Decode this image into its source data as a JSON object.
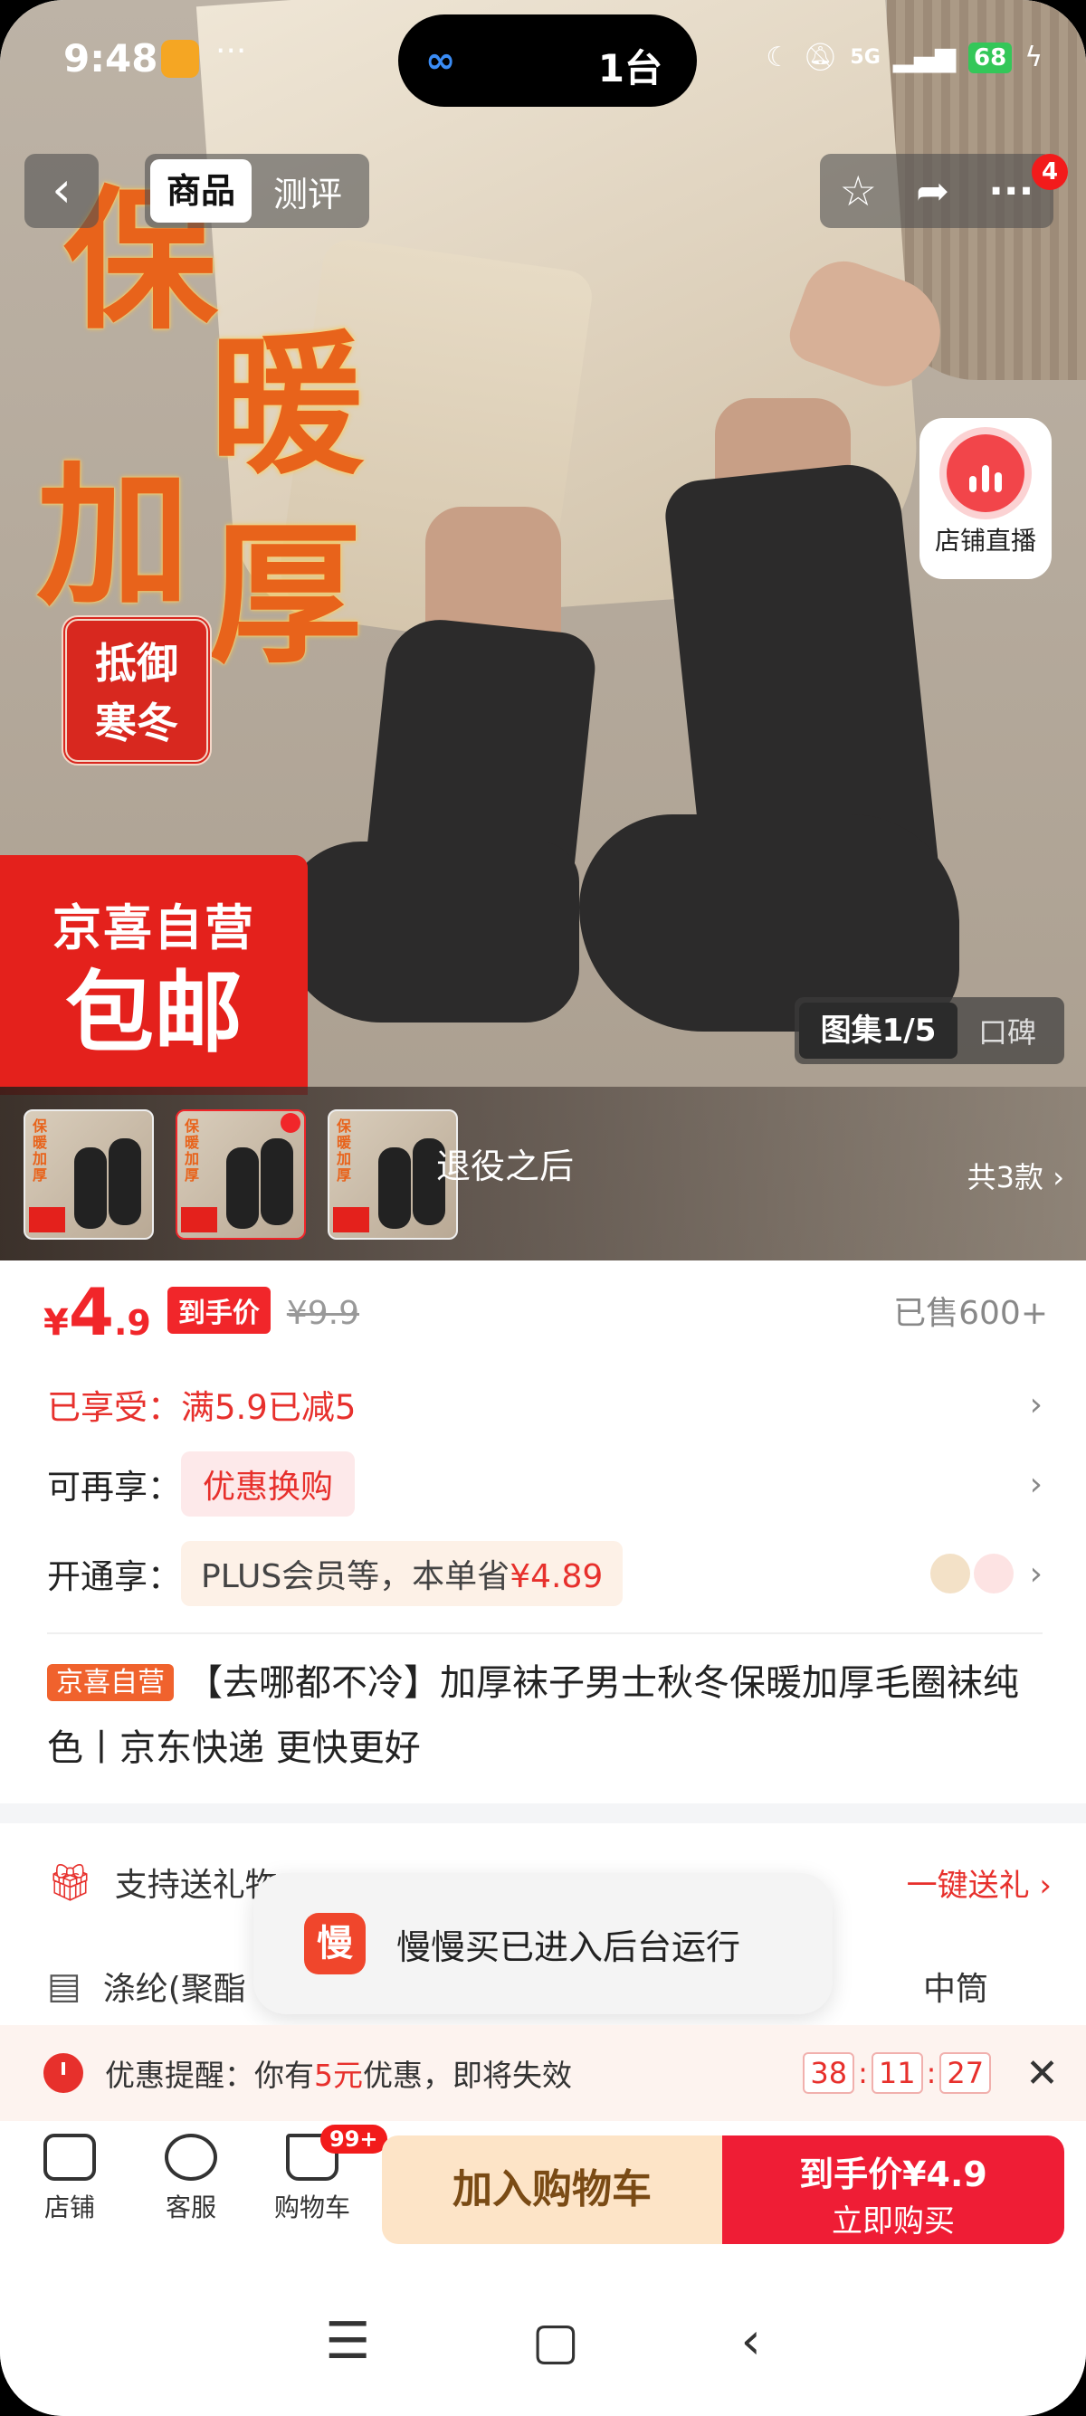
{
  "status_bar": {
    "time": "9:48",
    "island_text": "1台",
    "battery": "68",
    "network": "5G"
  },
  "hero": {
    "big_text": [
      "保",
      "暖",
      "加",
      "厚"
    ],
    "stamp": [
      "抵御",
      "寒冬"
    ],
    "promo_line1": "京喜自营",
    "promo_line2": "包邮",
    "live_label": "店铺直播"
  },
  "top_nav": {
    "back_icon": "chevron-left-icon",
    "tabs": [
      "商品",
      "测评"
    ],
    "badge": "4"
  },
  "gallery": {
    "tabs": [
      "图集1/5",
      "口碑"
    ]
  },
  "variants": {
    "name": "退役之后",
    "count": "共3款"
  },
  "price": {
    "symbol": "¥",
    "integer": "4",
    "decimal": ".9",
    "tag": "到手价",
    "original": "¥9.9",
    "sold": "已售600+"
  },
  "promo_rows": [
    {
      "label": "已享受：满5.9已减5"
    },
    {
      "label": "可再享：",
      "pill": "优惠换购"
    },
    {
      "label": "开通享：",
      "pill": "PLUS会员等，本单省",
      "amount": "¥4.89"
    }
  ],
  "product": {
    "tag": "京喜自营",
    "title": "【去哪都不冷】加厚袜子男士秋冬保暖加厚毛圈袜纯色丨京东快递 更快更好"
  },
  "service_rows": {
    "gift": "支持送礼物",
    "gift_link": "一键送礼",
    "material": "涤纶(聚酯",
    "height": "中筒"
  },
  "toast": {
    "app_char": "慢",
    "text": "慢慢买已进入后台运行"
  },
  "reminder": {
    "prefix": "优惠提醒：你有",
    "amount": "5元",
    "suffix": "优惠，即将失效",
    "timer": [
      "38",
      "11",
      "27"
    ]
  },
  "bottom_bar": {
    "shop": "店铺",
    "service": "客服",
    "cart": "购物车",
    "cart_badge": "99+",
    "add_cart": "加入购物车",
    "buy_line1": "到手价¥4.9",
    "buy_line2": "立即购买"
  }
}
